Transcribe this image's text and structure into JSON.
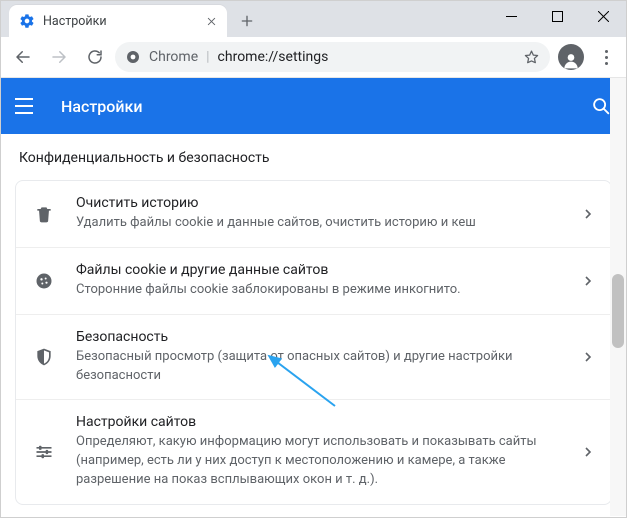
{
  "tab": {
    "title": "Настройки"
  },
  "omnibox": {
    "label": "Chrome",
    "url": "chrome://settings"
  },
  "appbar": {
    "title": "Настройки"
  },
  "section": {
    "title": "Конфиденциальность и безопасность"
  },
  "rows": [
    {
      "title": "Очистить историю",
      "sub": "Удалить файлы cookie и данные сайтов, очистить историю и кеш"
    },
    {
      "title": "Файлы cookie и другие данные сайтов",
      "sub": "Сторонние файлы cookie заблокированы в режиме инкогнито."
    },
    {
      "title": "Безопасность",
      "sub": "Безопасный просмотр (защита от опасных сайтов) и другие настройки безопасности"
    },
    {
      "title": "Настройки сайтов",
      "sub": "Определяют, какую информацию могут использовать и показывать сайты (например, есть ли у них доступ к местоположению и камере, а также разрешение на показ всплывающих окон и т. д.)."
    }
  ]
}
